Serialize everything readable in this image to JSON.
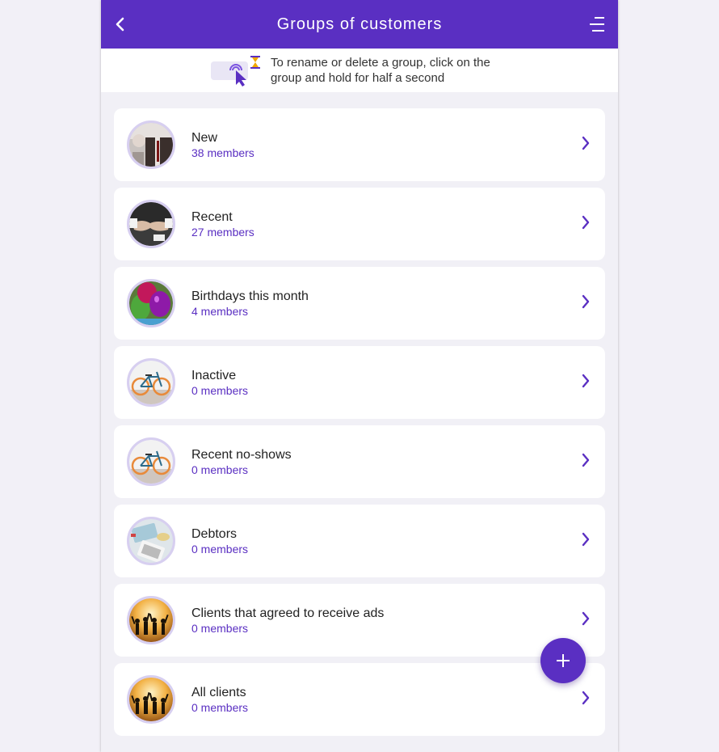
{
  "header": {
    "title": "Groups of customers",
    "back_icon": "chevron-left-icon",
    "menu_icon": "menu-icon"
  },
  "hint": {
    "text": "To rename or delete a group, click on the group and hold for half a second",
    "icons": [
      "tap-hold-icon",
      "hourglass-icon"
    ]
  },
  "groups": [
    {
      "name": "New",
      "count": "38 members",
      "image": "businessman-photo"
    },
    {
      "name": "Recent",
      "count": "27 members",
      "image": "handshake-photo"
    },
    {
      "name": "Birthdays this month",
      "count": "4 members",
      "image": "balloons-photo"
    },
    {
      "name": "Inactive",
      "count": "0 members",
      "image": "bicycle-photo"
    },
    {
      "name": "Recent no-shows",
      "count": "0 members",
      "image": "bicycle-photo"
    },
    {
      "name": "Debtors",
      "count": "0 members",
      "image": "calculator-money-photo"
    },
    {
      "name": "Clients that agreed to receive ads",
      "count": "0 members",
      "image": "party-silhouettes-photo"
    },
    {
      "name": "All clients",
      "count": "0 members",
      "image": "party-silhouettes-photo"
    }
  ],
  "fab": {
    "icon": "plus-icon"
  },
  "colors": {
    "primary": "#5a2fc2",
    "background": "#f1f0f6",
    "card": "#ffffff",
    "avatar_ring": "#d7cff0"
  }
}
